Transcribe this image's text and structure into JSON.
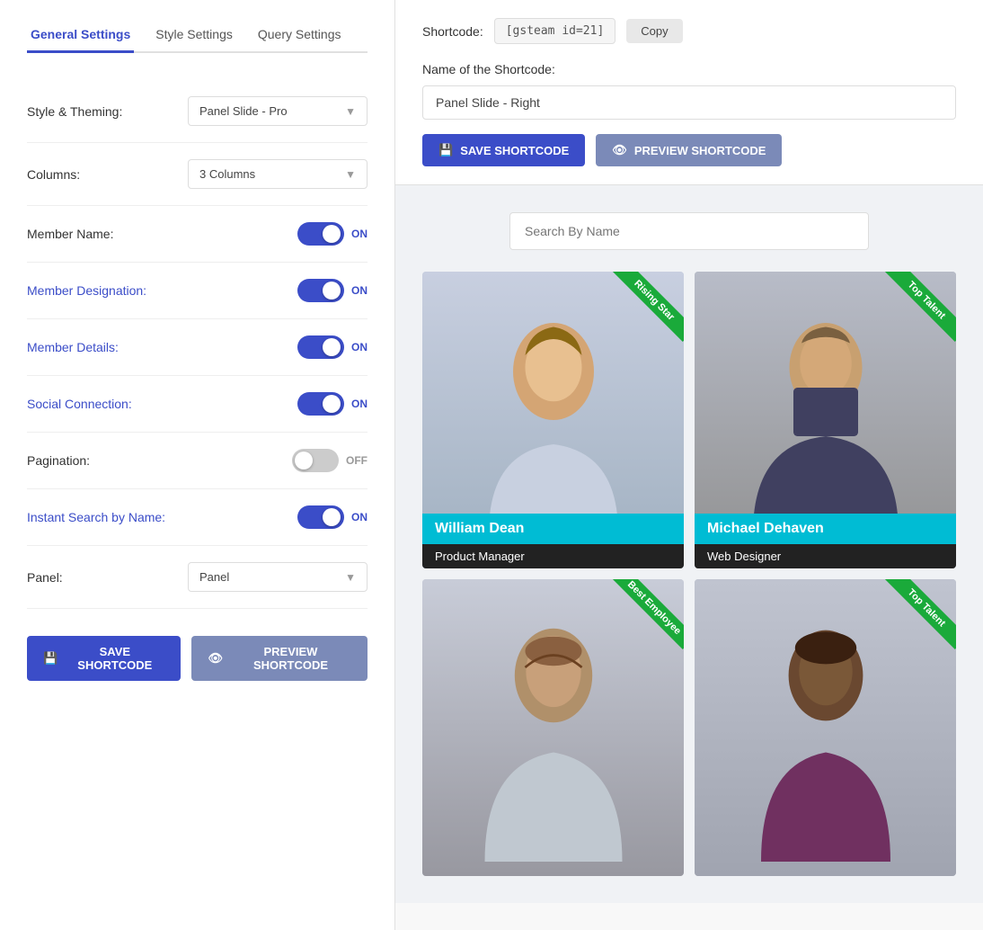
{
  "tabs": [
    {
      "label": "General Settings",
      "id": "general",
      "active": true
    },
    {
      "label": "Style Settings",
      "id": "style",
      "active": false
    },
    {
      "label": "Query Settings",
      "id": "query",
      "active": false
    }
  ],
  "settings": {
    "style_theming": {
      "label": "Style & Theming:",
      "value": "Panel Slide - Pro"
    },
    "columns": {
      "label": "Columns:",
      "value": "3 Columns"
    },
    "member_name": {
      "label": "Member Name:",
      "toggle": "on"
    },
    "member_designation": {
      "label": "Member Designation:",
      "toggle": "on",
      "blue": true
    },
    "member_details": {
      "label": "Member Details:",
      "toggle": "on",
      "blue": true
    },
    "social_connection": {
      "label": "Social Connection:",
      "toggle": "on",
      "blue": true
    },
    "pagination": {
      "label": "Pagination:",
      "toggle": "off"
    },
    "instant_search": {
      "label": "Instant Search by Name:",
      "toggle": "on",
      "blue": true
    },
    "panel": {
      "label": "Panel:",
      "value": "Panel"
    }
  },
  "buttons": {
    "save_label": "SAVE SHORTCODE",
    "preview_label": "PREVIEW SHORTCODE"
  },
  "shortcode": {
    "label": "Shortcode:",
    "code": "[gsteam id=21]",
    "copy_label": "Copy",
    "name_label": "Name of the Shortcode:",
    "name_value": "Panel Slide - Right"
  },
  "search_placeholder": "Search By Name",
  "team_members": [
    {
      "name": "William Dean",
      "designation": "Product Manager",
      "ribbon": "Rising Star",
      "ribbon_color": "#1aaa3a"
    },
    {
      "name": "Michael Dehaven",
      "designation": "Web Designer",
      "ribbon": "Top Talent",
      "ribbon_color": "#1aaa3a"
    },
    {
      "name": "",
      "designation": "",
      "ribbon": "Best Employee",
      "ribbon_color": "#1aaa3a"
    },
    {
      "name": "",
      "designation": "",
      "ribbon": "Top Talent",
      "ribbon_color": "#1aaa3a"
    }
  ],
  "on_label": "ON",
  "off_label": "OFF"
}
